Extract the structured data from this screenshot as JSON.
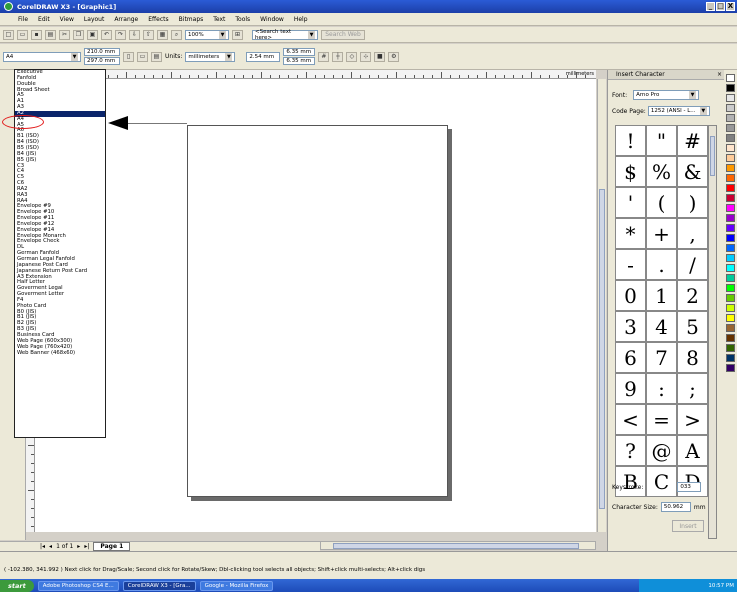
{
  "window": {
    "title": "CorelDRAW X3 - [Graphic1]",
    "min_label": "_",
    "max_label": "□",
    "close_label": "X"
  },
  "menu": [
    "File",
    "Edit",
    "View",
    "Layout",
    "Arrange",
    "Effects",
    "Bitmaps",
    "Text",
    "Tools",
    "Window",
    "Help"
  ],
  "standard_toolbar": {
    "zoom": "100%",
    "search_placeholder": "<Search text here>",
    "search_button": "Search Web"
  },
  "property_bar": {
    "paper": "A4",
    "width": "210.0 mm",
    "height": "297.0 mm",
    "units_label": "Units:",
    "units": "millimeters",
    "nudge": "2.54 mm",
    "dup_x": "6.35 mm",
    "dup_y": "6.35 mm"
  },
  "paper_list": [
    "Executive",
    "Fanfold",
    "Double",
    "Broad Sheet",
    "A5",
    "A1",
    "A3",
    "A2",
    "A4",
    "A5",
    "A6",
    "B1 (ISO)",
    "B4 (ISO)",
    "B5 (ISO)",
    "B4 (JIS)",
    "B5 (JIS)",
    "C3",
    "C4",
    "C5",
    "C6",
    "RA2",
    "RA3",
    "RA4",
    "Envelope #9",
    "Envelope #10",
    "Envelope #11",
    "Envelope #12",
    "Envelope #14",
    "Envelope Monarch",
    "Envelope Check",
    "DL",
    "German Fanfold",
    "German Legal Fanfold",
    "Japanese Post Card",
    "Japanese Return Post Card",
    "A3 Extension",
    "Half Letter",
    "Goverment Legal",
    "Goverment Letter",
    "F4",
    "Photo Card",
    "B0 (JIS)",
    "B1 (JIS)",
    "B2 (JIS)",
    "B3 (JIS)",
    "Business Card",
    "Web Page (600x300)",
    "Web Page (760x420)",
    "Web Banner (468x60)"
  ],
  "selected_index": 7,
  "ruler_label": "millimeters",
  "docker": {
    "title": "Insert Character",
    "font_label": "Font:",
    "font": "Arno Pro",
    "code_page_label": "Code Page:",
    "code_page": "1252 (ANSI - L...",
    "chars": [
      "!",
      "\"",
      "#",
      "$",
      "%",
      "&",
      "'",
      "(",
      ")",
      "*",
      "+",
      ",",
      "-",
      ".",
      "/",
      "0",
      "1",
      "2",
      "3",
      "4",
      "5",
      "6",
      "7",
      "8",
      "9",
      ":",
      ";",
      "<",
      "=",
      ">",
      "?",
      "@",
      "A",
      "B",
      "C",
      "D"
    ],
    "keystroke_label": "Keystroke:",
    "keystroke_value": "033",
    "char_size_label": "Character Size:",
    "char_size_value": "50.962",
    "char_size_unit": "mm",
    "insert_button": "Insert"
  },
  "page_tab": {
    "counter": "1 of 1",
    "tab": "Page 1"
  },
  "status_text": "( -102.380, 341.992 )   Next click for Drag/Scale; Second click for Rotate/Skew; Dbl-clicking tool selects all objects; Shift+click multi-selects; Alt+click digs",
  "taskbar": {
    "start": "start",
    "tasks": [
      "Adobe Photoshop CS4 E...",
      "CorelDRAW X3 - [Gra...",
      "Google - Mozilla Firefox"
    ],
    "clock": "10:57 PM"
  },
  "palette_colors": [
    "#ffffff",
    "#000000",
    "#e6e6e6",
    "#cccccc",
    "#b3b3b3",
    "#999999",
    "#808080",
    "#ffe5cc",
    "#ffcc99",
    "#ff9900",
    "#ff6600",
    "#ff0000",
    "#cc0033",
    "#ff00ff",
    "#9900cc",
    "#6600ff",
    "#0000ff",
    "#0066ff",
    "#00ccff",
    "#00ffff",
    "#00cc99",
    "#00ff00",
    "#66cc00",
    "#ccff00",
    "#ffff00",
    "#996633",
    "#663300",
    "#336600",
    "#003366",
    "#330066"
  ]
}
